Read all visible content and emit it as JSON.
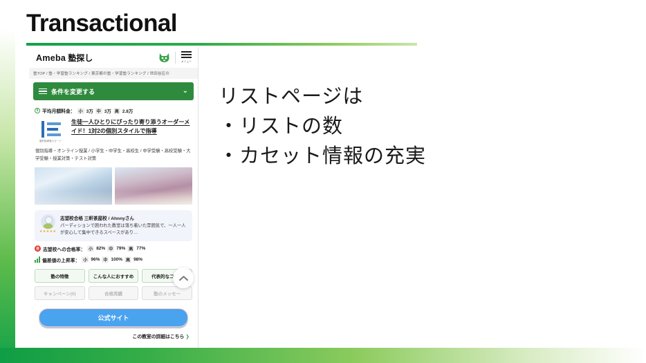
{
  "slide": {
    "title": "Transactional",
    "accent_green": "#13a24a",
    "accent_blue": "#4aa3ef"
  },
  "copy": {
    "lines": [
      "リストページは",
      "・リストの数",
      "・カセット情報の充実"
    ]
  },
  "phone": {
    "header": {
      "brand_ameba": "Ameba",
      "brand_jp": "塾探し",
      "mascot_icon": "cat-mascot-icon",
      "menu_icon": "hamburger-menu-icon",
      "menu_label": "メニュー"
    },
    "breadcrumb": "塾TOP / 塾・学習塾ランキング / 東京都の塾・学習塾ランキング / 世田谷区の",
    "filter_bar": {
      "label": "条件を変更する",
      "icon": "filter-icon",
      "chevron": "⌄"
    },
    "card": {
      "price": {
        "icon": "yen-coin-icon",
        "label": "平均月額料金：",
        "items": [
          {
            "grade": "小",
            "value": "3万"
          },
          {
            "grade": "中",
            "value": "3万"
          },
          {
            "grade": "高",
            "value": "2.8万"
          }
        ]
      },
      "logo_caption": "個別指導塾スピード",
      "school_title": "生徒一人ひとりにぴったり寄り添うオーダーメイド！1対2の個別スタイルで指導",
      "tags": "個別指導・オンライン授業 / 小学生・中学生・高校生 / 中学受験・高校受験・大学受験・授業対策・テスト対策",
      "photos": [
        "classroom-photo-1",
        "classroom-photo-2"
      ],
      "review": {
        "avatar": "user-avatar",
        "stars": "★★★★★",
        "title": "志望校合格 三軒茶屋校 / Ahnnyさん",
        "body": "パーディションで囲われた教室は落ち着いた雰囲気で、一人一人が安心して集中できるスペースがあり…"
      },
      "pass_rate": {
        "icon": "pass-rate-icon",
        "label": "志望校への合格率：",
        "items": [
          {
            "grade": "小",
            "value": "82%"
          },
          {
            "grade": "中",
            "value": "79%"
          },
          {
            "grade": "高",
            "value": "77%"
          }
        ]
      },
      "score_rate": {
        "icon": "bar-chart-icon",
        "label": "偏差値の上昇率：",
        "items": [
          {
            "grade": "小",
            "value": "96%"
          },
          {
            "grade": "中",
            "value": "100%"
          },
          {
            "grade": "高",
            "value": "98%"
          }
        ]
      },
      "chips": [
        {
          "label": "塾の特徴",
          "muted": false
        },
        {
          "label": "こんな人におすすめ",
          "muted": false
        },
        {
          "label": "代表的なコース",
          "muted": false
        },
        {
          "label": "キャンペーン(0)",
          "muted": true
        },
        {
          "label": "合格実績",
          "muted": true
        },
        {
          "label": "塾のメッセー",
          "muted": true
        }
      ],
      "cta_label": "公式サイト",
      "detail_link": "この教室の詳細はこちら",
      "detail_arrow": "❯"
    },
    "scroll_top_icon": "chevron-up-icon"
  }
}
